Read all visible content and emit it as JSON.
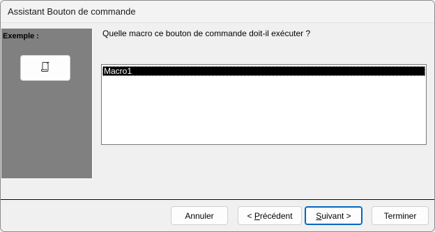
{
  "window": {
    "title": "Assistant Bouton de commande"
  },
  "sidebar": {
    "label": "Exemple :",
    "example_icon": "macro-scroll-icon"
  },
  "main": {
    "question": "Quelle macro ce bouton de commande doit-il exécuter ?",
    "macros": [
      {
        "label": "Macro1",
        "selected": true
      }
    ]
  },
  "footer": {
    "cancel_label": "Annuler",
    "prev_prefix": "< ",
    "prev_mnemonic": "P",
    "prev_rest": "récédent",
    "next_mnemonic": "S",
    "next_rest": "uivant >",
    "finish_label": "Terminer"
  },
  "colors": {
    "sidebar_bg": "#808080",
    "selection_bg": "#000000",
    "default_button_border": "#0067c0"
  }
}
